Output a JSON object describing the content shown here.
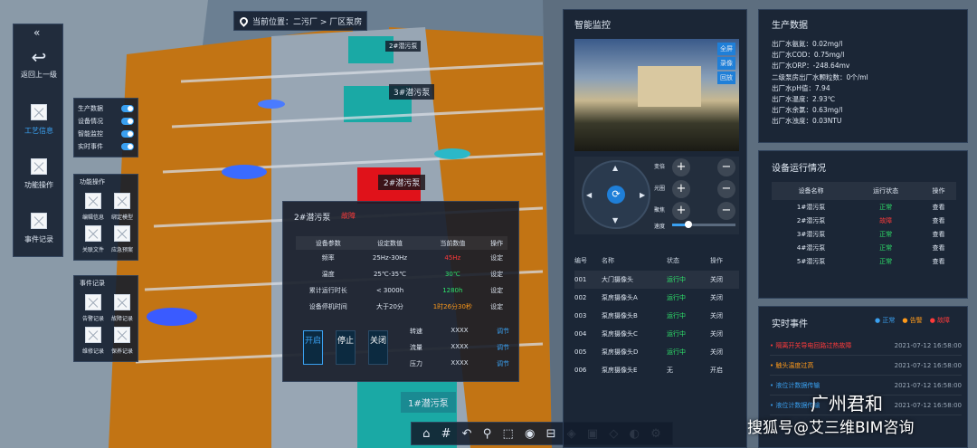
{
  "breadcrumb": {
    "text": "当前位置：二污厂 > 厂区泵房"
  },
  "scene": {
    "labels": [
      "2#潜污泵",
      "3#潜污泵",
      "2#潜污泵",
      "1#潜污泵"
    ]
  },
  "nav": {
    "back_label": "返回上一级",
    "items": [
      "工艺信息",
      "功能操作",
      "事件记录"
    ]
  },
  "toggles": [
    "生产数据",
    "设备情况",
    "智能监控",
    "实时事件"
  ],
  "func_ops": {
    "title": "功能操作",
    "items": [
      "编辑信息",
      "绑定模型",
      "关联文件",
      "应急预案"
    ]
  },
  "event_ops": {
    "title": "事件记录",
    "items": [
      "告警记录",
      "故障记录",
      "维修记录",
      "保养记录"
    ]
  },
  "pump_popup": {
    "title": "2#潜污泵",
    "status": "故障",
    "headers": [
      "设备参数",
      "设定数值",
      "当前数值",
      "操作"
    ],
    "rows": [
      [
        "频率",
        "25Hz-30Hz",
        "45Hz",
        "设定"
      ],
      [
        "温度",
        "25℃-35℃",
        "30℃",
        "设定"
      ],
      [
        "累计运行时长",
        "< 3000h",
        "1280h",
        "设定"
      ],
      [
        "设备停机时间",
        "大于20分",
        "1时26分30秒",
        "设定"
      ]
    ],
    "btn_start": "开启",
    "btn_stop": "停止",
    "btn_close": "关闭",
    "controls": [
      {
        "label": "转速",
        "value": "XXXX",
        "action": "调节"
      },
      {
        "label": "流量",
        "value": "XXXX",
        "action": "调节"
      },
      {
        "label": "压力",
        "value": "XXXX",
        "action": "调节"
      }
    ]
  },
  "monitor": {
    "title": "智能监控",
    "buttons": [
      "全屏",
      "录像",
      "回放"
    ],
    "ptz": [
      "变倍",
      "光圈",
      "聚焦",
      "速度"
    ],
    "speed_level": 0.25,
    "cam_headers": [
      "编号",
      "名称",
      "状态",
      "操作"
    ],
    "cameras": [
      {
        "id": "001",
        "name": "大门摄像头",
        "status": "运行中",
        "op": "关闭"
      },
      {
        "id": "002",
        "name": "泵房摄像头A",
        "status": "运行中",
        "op": "关闭"
      },
      {
        "id": "003",
        "name": "泵房摄像头B",
        "status": "运行中",
        "op": "关闭"
      },
      {
        "id": "004",
        "name": "泵房摄像头C",
        "status": "运行中",
        "op": "关闭"
      },
      {
        "id": "005",
        "name": "泵房摄像头D",
        "status": "运行中",
        "op": "关闭"
      },
      {
        "id": "006",
        "name": "泵房摄像头E",
        "status": "无",
        "op": "开启"
      }
    ],
    "status_colors": {
      "运行中": "#2ee26a",
      "无": "#dfe7f2"
    }
  },
  "production": {
    "title": "生产数据",
    "items": [
      "出厂水氨氮：0.02mg/l",
      "出厂水COD：0.75mg/l",
      "出厂水ORP：-248.64mv",
      "二级泵房出厂水颗粒数：0个/ml",
      "出厂水pH值：7.94",
      "出厂水温度：2.93℃",
      "出厂水余氯：0.63mg/l",
      "出厂水浊度：0.03NTU"
    ]
  },
  "equipment": {
    "title": "设备运行情况",
    "headers": [
      "设备名称",
      "运行状态",
      "操作"
    ],
    "rows": [
      {
        "name": "1#潜污泵",
        "status": "正常",
        "op": "查看",
        "color": "#2ee26a"
      },
      {
        "name": "2#潜污泵",
        "status": "故障",
        "op": "查看",
        "color": "#ff3a3a"
      },
      {
        "name": "3#潜污泵",
        "status": "正常",
        "op": "查看",
        "color": "#2ee26a"
      },
      {
        "name": "4#潜污泵",
        "status": "正常",
        "op": "查看",
        "color": "#2ee26a"
      },
      {
        "name": "5#潜污泵",
        "status": "正常",
        "op": "查看",
        "color": "#2ee26a"
      }
    ]
  },
  "events": {
    "title": "实时事件",
    "legend": [
      "正常",
      "告警",
      "故障"
    ],
    "items": [
      {
        "text": "隔离开关导电回路过热故障",
        "time": "2021-07-12 16:58:00",
        "color": "#ff3a3a"
      },
      {
        "text": "触头温度过高",
        "time": "2021-07-12 16:58:00",
        "color": "#ff9a1a"
      },
      {
        "text": "液位计数据传输",
        "time": "2021-07-12 16:58:00",
        "color": "#3aa0f0"
      },
      {
        "text": "液位计数据传输",
        "time": "2021-07-12 16:58:00",
        "color": "#3aa0f0"
      }
    ]
  },
  "watermark": {
    "brand": "广州君和",
    "account": "搜狐号@艾三维BIM咨询"
  }
}
